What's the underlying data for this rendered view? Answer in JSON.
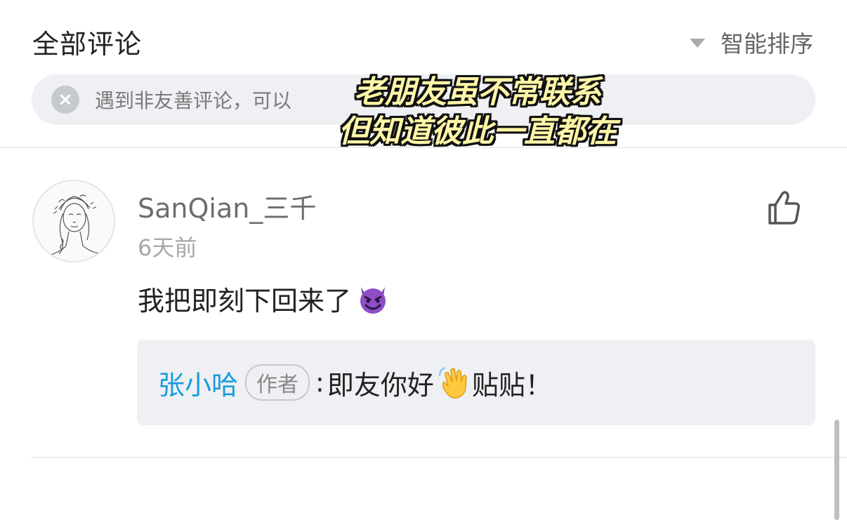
{
  "header": {
    "title": "全部评论",
    "sort_label": "智能排序"
  },
  "notice": {
    "text": "遇到非友善评论，可以"
  },
  "caption": {
    "line1": "老朋友虽不常联系",
    "line2": "但知道彼此一直都在"
  },
  "comment": {
    "username": "SanQian_三千",
    "time": "6天前",
    "text": "我把即刻下回来了",
    "emoji": "smiling-devil",
    "reply": {
      "author": "张小哈",
      "badge": "作者",
      "colon": ":",
      "text": "即友你好",
      "emoji": "waving-hand",
      "tail": "贴贴！"
    }
  },
  "colors": {
    "accent_blue": "#1a9bde",
    "panel_bg": "#eef0f3",
    "caption_fill": "#fff6a8"
  }
}
